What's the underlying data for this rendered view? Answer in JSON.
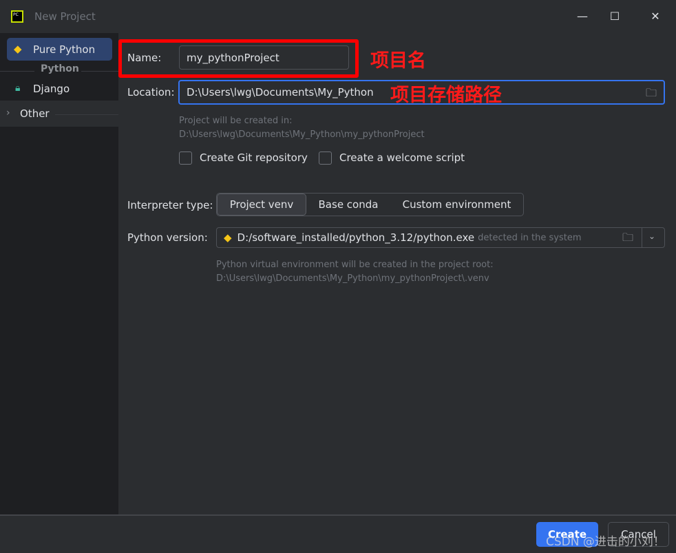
{
  "window": {
    "title": "New Project",
    "minimize": "—",
    "maximize": "☐",
    "close": "✕",
    "logo": "PC"
  },
  "sidebar": {
    "items": [
      {
        "label": "Pure Python",
        "icon": "python-icon",
        "selected": true
      },
      {
        "label": "Django",
        "icon": "lock-icon"
      }
    ],
    "group_label": "Python",
    "other_label": "Other"
  },
  "form": {
    "name_label": "Name:",
    "name_value": "my_pythonProject",
    "location_label": "Location:",
    "location_value": "D:\\Users\\lwg\\Documents\\My_Python",
    "created_in_hint": "Project will be created in:",
    "created_in_path": "D:\\Users\\lwg\\Documents\\My_Python\\my_pythonProject",
    "git_label": "Create Git repository",
    "git_checked": false,
    "welcome_label": "Create a welcome script",
    "welcome_checked": false,
    "interp_label": "Interpreter type:",
    "interp_options": [
      "Project venv",
      "Base conda",
      "Custom environment"
    ],
    "interp_selected": "Project venv",
    "python_label": "Python version:",
    "python_path": "D:/software_installed/python_3.12/python.exe",
    "python_detected": "detected in the system",
    "venv_hint": "Python virtual environment will be created in the project root:",
    "venv_path": "D:\\Users\\lwg\\Documents\\My_Python\\my_pythonProject\\.venv"
  },
  "footer": {
    "create": "Create",
    "cancel": "Cancel"
  },
  "annotations": {
    "name": "项目名",
    "location": "项目存储路径",
    "watermark": "CSDN @进击的小刘！"
  },
  "colors": {
    "accent": "#3574f0",
    "annotation": "#ff0000",
    "selected": "#2e436e"
  }
}
